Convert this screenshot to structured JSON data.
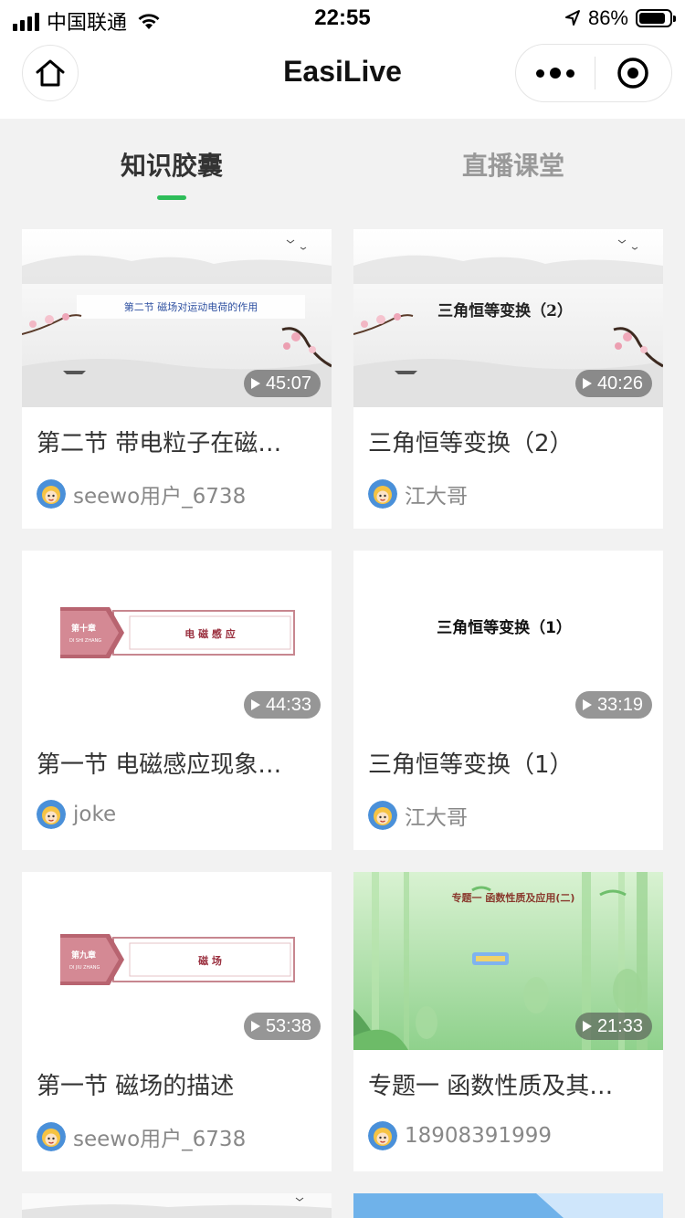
{
  "status_bar": {
    "carrier": "中国联通",
    "time": "22:55",
    "battery_pct": "86%",
    "battery_level": 0.86
  },
  "nav": {
    "title": "EasiLive"
  },
  "tabs": [
    {
      "label": "知识胶囊",
      "active": true
    },
    {
      "label": "直播课堂",
      "active": false
    }
  ],
  "cards": [
    {
      "title": "第二节 带电粒子在磁…",
      "author": "seewo用户_6738",
      "duration": "45:07",
      "thumb_text": "第二节    磁场对运动电荷的作用",
      "thumb_style": "ink-landscape"
    },
    {
      "title": "三角恒等变换（2）",
      "author": "江大哥",
      "duration": "40:26",
      "thumb_text": "三角恒等变换（2）",
      "thumb_style": "ink-landscape"
    },
    {
      "title": "第一节 电磁感应现象…",
      "author": "joke",
      "duration": "44:33",
      "thumb_text": "电 磁 感 应",
      "thumb_chapter": "第十章",
      "thumb_chapter_pinyin": "DI SHI ZHANG",
      "thumb_style": "chapter-banner"
    },
    {
      "title": "三角恒等变换（1）",
      "author": "江大哥",
      "duration": "33:19",
      "thumb_text": "三角恒等变换（1）",
      "thumb_style": "plain"
    },
    {
      "title": "第一节 磁场的描述",
      "author": "seewo用户_6738",
      "duration": "53:38",
      "thumb_text": "磁    场",
      "thumb_chapter": "第九章",
      "thumb_chapter_pinyin": "DI JIU ZHANG",
      "thumb_style": "chapter-banner"
    },
    {
      "title": "专题一 函数性质及其…",
      "author": "18908391999",
      "duration": "21:33",
      "thumb_text": "专题一    函数性质及应用(二)",
      "thumb_style": "bamboo"
    }
  ],
  "colors": {
    "accent": "#2ebd59",
    "page_bg": "#f2f2f2",
    "card_bg": "#ffffff"
  }
}
